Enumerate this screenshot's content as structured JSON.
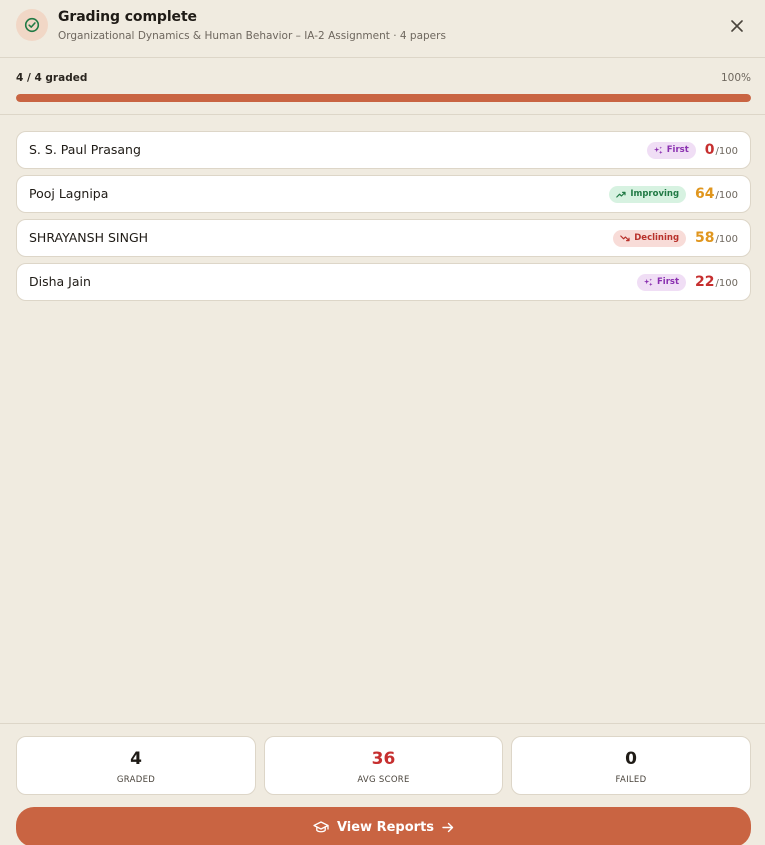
{
  "header": {
    "title": "Grading complete",
    "subtitle": "Organizational Dynamics & Human Behavior – IA-2 Assignment · 4 papers",
    "icon": "check-circle-icon",
    "close_icon": "close-icon"
  },
  "progress": {
    "label": "4 / 4 graded",
    "percent_label": "100%",
    "fraction": 1.0
  },
  "students": [
    {
      "name": "S. S. Paul Prasang",
      "badge": "First",
      "badge_type": "first",
      "score": "0",
      "max": "/100",
      "score_color": "#c62f2f"
    },
    {
      "name": "Pooj Lagnipa",
      "badge": "Improving",
      "badge_type": "improving",
      "score": "64",
      "max": "/100",
      "score_color": "#e0961e"
    },
    {
      "name": "SHRAYANSH SINGH",
      "badge": "Declining",
      "badge_type": "declining",
      "score": "58",
      "max": "/100",
      "score_color": "#e0961e"
    },
    {
      "name": "Disha Jain",
      "badge": "First",
      "badge_type": "first",
      "score": "22",
      "max": "/100",
      "score_color": "#c62f2f"
    }
  ],
  "stats": {
    "graded": {
      "value": "4",
      "label": "GRADED",
      "color": "#1f1b16"
    },
    "avg": {
      "value": "36",
      "label": "AVG SCORE",
      "color": "#c62f2f"
    },
    "failed": {
      "value": "0",
      "label": "FAILED",
      "color": "#1f1b16"
    }
  },
  "cta": {
    "label": "View Reports",
    "icon": "graduation-cap-icon",
    "arrow_icon": "arrow-right-icon"
  },
  "colors": {
    "accent": "#c96442",
    "background": "#f0ebe0",
    "success": "#217a45"
  }
}
